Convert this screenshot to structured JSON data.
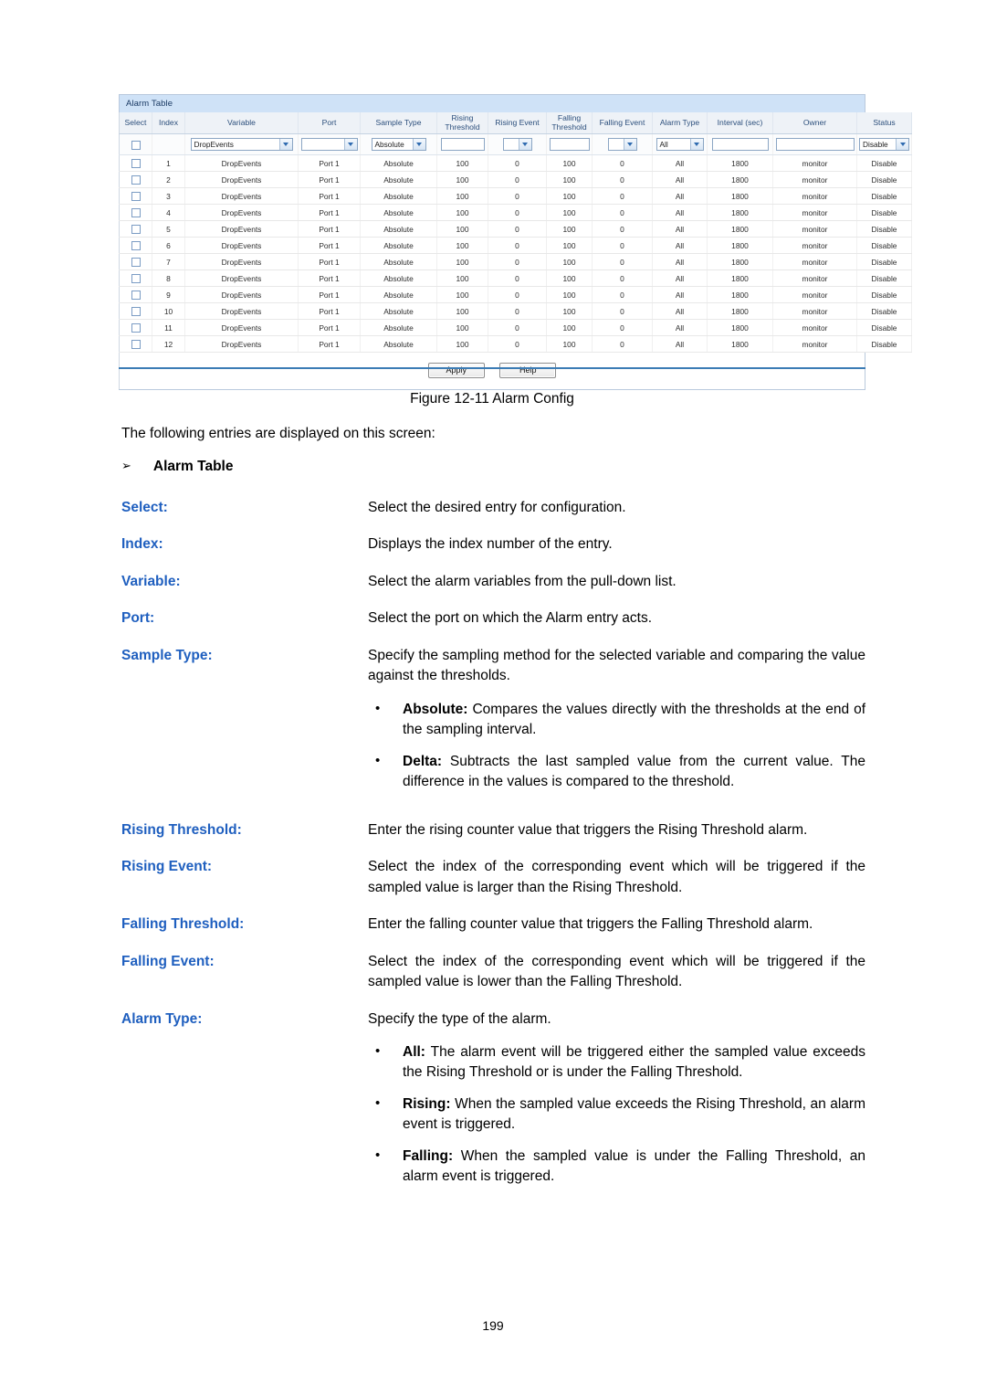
{
  "screenshot": {
    "title": "Alarm Table",
    "columns": [
      "Select",
      "Index",
      "Variable",
      "Port",
      "Sample Type",
      "Rising Threshold",
      "Rising Event",
      "Falling Threshold",
      "Falling Event",
      "Alarm Type",
      "Interval (sec)",
      "Owner",
      "Status"
    ],
    "input_row": {
      "select_checkbox": "",
      "variable_value": "DropEvents",
      "port_value": "",
      "sample_type_value": "Absolute",
      "rising_threshold_value": "",
      "rising_event_value": "",
      "falling_threshold_value": "",
      "falling_event_value": "",
      "alarm_type_value": "All",
      "interval_value": "",
      "owner_value": "",
      "status_value": "Disable"
    },
    "rows": [
      {
        "index": "1",
        "variable": "DropEvents",
        "port": "Port 1",
        "sample_type": "Absolute",
        "rising_threshold": "100",
        "rising_event": "0",
        "falling_threshold": "100",
        "falling_event": "0",
        "alarm_type": "All",
        "interval": "1800",
        "owner": "monitor",
        "status": "Disable"
      },
      {
        "index": "2",
        "variable": "DropEvents",
        "port": "Port 1",
        "sample_type": "Absolute",
        "rising_threshold": "100",
        "rising_event": "0",
        "falling_threshold": "100",
        "falling_event": "0",
        "alarm_type": "All",
        "interval": "1800",
        "owner": "monitor",
        "status": "Disable"
      },
      {
        "index": "3",
        "variable": "DropEvents",
        "port": "Port 1",
        "sample_type": "Absolute",
        "rising_threshold": "100",
        "rising_event": "0",
        "falling_threshold": "100",
        "falling_event": "0",
        "alarm_type": "All",
        "interval": "1800",
        "owner": "monitor",
        "status": "Disable"
      },
      {
        "index": "4",
        "variable": "DropEvents",
        "port": "Port 1",
        "sample_type": "Absolute",
        "rising_threshold": "100",
        "rising_event": "0",
        "falling_threshold": "100",
        "falling_event": "0",
        "alarm_type": "All",
        "interval": "1800",
        "owner": "monitor",
        "status": "Disable"
      },
      {
        "index": "5",
        "variable": "DropEvents",
        "port": "Port 1",
        "sample_type": "Absolute",
        "rising_threshold": "100",
        "rising_event": "0",
        "falling_threshold": "100",
        "falling_event": "0",
        "alarm_type": "All",
        "interval": "1800",
        "owner": "monitor",
        "status": "Disable"
      },
      {
        "index": "6",
        "variable": "DropEvents",
        "port": "Port 1",
        "sample_type": "Absolute",
        "rising_threshold": "100",
        "rising_event": "0",
        "falling_threshold": "100",
        "falling_event": "0",
        "alarm_type": "All",
        "interval": "1800",
        "owner": "monitor",
        "status": "Disable"
      },
      {
        "index": "7",
        "variable": "DropEvents",
        "port": "Port 1",
        "sample_type": "Absolute",
        "rising_threshold": "100",
        "rising_event": "0",
        "falling_threshold": "100",
        "falling_event": "0",
        "alarm_type": "All",
        "interval": "1800",
        "owner": "monitor",
        "status": "Disable"
      },
      {
        "index": "8",
        "variable": "DropEvents",
        "port": "Port 1",
        "sample_type": "Absolute",
        "rising_threshold": "100",
        "rising_event": "0",
        "falling_threshold": "100",
        "falling_event": "0",
        "alarm_type": "All",
        "interval": "1800",
        "owner": "monitor",
        "status": "Disable"
      },
      {
        "index": "9",
        "variable": "DropEvents",
        "port": "Port 1",
        "sample_type": "Absolute",
        "rising_threshold": "100",
        "rising_event": "0",
        "falling_threshold": "100",
        "falling_event": "0",
        "alarm_type": "All",
        "interval": "1800",
        "owner": "monitor",
        "status": "Disable"
      },
      {
        "index": "10",
        "variable": "DropEvents",
        "port": "Port 1",
        "sample_type": "Absolute",
        "rising_threshold": "100",
        "rising_event": "0",
        "falling_threshold": "100",
        "falling_event": "0",
        "alarm_type": "All",
        "interval": "1800",
        "owner": "monitor",
        "status": "Disable"
      },
      {
        "index": "11",
        "variable": "DropEvents",
        "port": "Port 1",
        "sample_type": "Absolute",
        "rising_threshold": "100",
        "rising_event": "0",
        "falling_threshold": "100",
        "falling_event": "0",
        "alarm_type": "All",
        "interval": "1800",
        "owner": "monitor",
        "status": "Disable"
      },
      {
        "index": "12",
        "variable": "DropEvents",
        "port": "Port 1",
        "sample_type": "Absolute",
        "rising_threshold": "100",
        "rising_event": "0",
        "falling_threshold": "100",
        "falling_event": "0",
        "alarm_type": "All",
        "interval": "1800",
        "owner": "monitor",
        "status": "Disable"
      }
    ],
    "buttons": {
      "apply": "Apply",
      "help": "Help"
    }
  },
  "document": {
    "figure_caption": "Figure 12-11 Alarm Config",
    "intro": "The following entries are displayed on this screen:",
    "section_arrow": "➢",
    "section_title": "Alarm Table",
    "definitions": [
      {
        "term": "Select:",
        "body": "Select the desired entry for configuration.",
        "bullets": []
      },
      {
        "term": "Index:",
        "body": "Displays the index number of the entry.",
        "bullets": []
      },
      {
        "term": "Variable:",
        "body": "Select the alarm variables from the pull-down list.",
        "bullets": []
      },
      {
        "term": "Port:",
        "body": "Select the port on which the Alarm entry acts.",
        "bullets": []
      },
      {
        "term": "Sample Type:",
        "body": "Specify the sampling method for the selected variable and comparing the value against the thresholds.",
        "bullets": [
          {
            "label": "Absolute:",
            "text": " Compares the values directly with the thresholds at the end of the sampling interval."
          },
          {
            "label": "Delta:",
            "text": " Subtracts the last sampled value from the current value. The difference in the values is compared to the threshold."
          }
        ]
      },
      {
        "term": "Rising Threshold:",
        "body": "Enter the rising counter value that triggers the Rising Threshold alarm.",
        "bullets": []
      },
      {
        "term": "Rising Event:",
        "body": "Select the index of the corresponding event which will be triggered if the sampled value is larger than the Rising Threshold.",
        "bullets": []
      },
      {
        "term": "Falling Threshold:",
        "body": "Enter the falling counter value that triggers the Falling Threshold alarm.",
        "bullets": []
      },
      {
        "term": "Falling Event:",
        "body": "Select the index of the corresponding event which will be triggered if the sampled value is lower than the Falling Threshold.",
        "bullets": []
      },
      {
        "term": "Alarm Type:",
        "body": "Specify the type of the alarm.",
        "bullets": [
          {
            "label": "All:",
            "text": " The alarm event will be triggered either the sampled value exceeds the Rising Threshold or is under the Falling Threshold."
          },
          {
            "label": "Rising:",
            "text": " When the sampled value exceeds the Rising Threshold, an alarm event is triggered."
          },
          {
            "label": "Falling:",
            "text": " When the sampled value is under the Falling Threshold, an alarm event is triggered."
          }
        ]
      }
    ],
    "page_number": "199"
  }
}
